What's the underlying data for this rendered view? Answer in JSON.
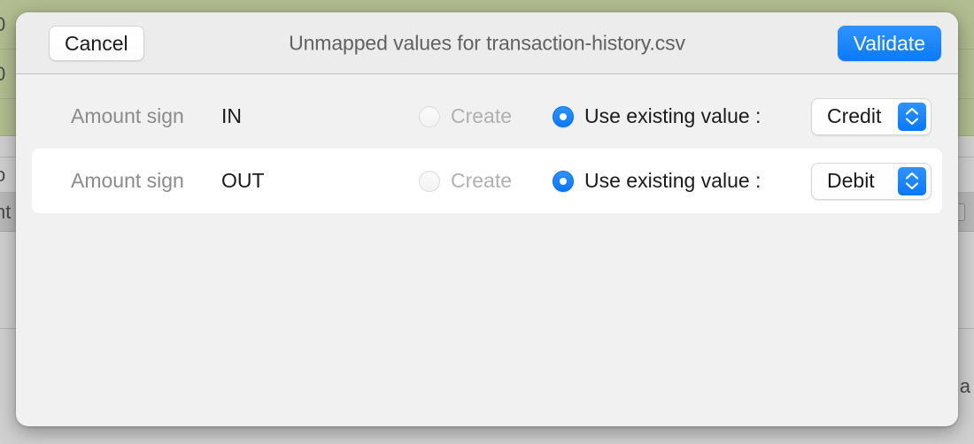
{
  "background": {
    "rows": [
      {
        "style": "green",
        "left_text": "0",
        "right_text": ""
      },
      {
        "style": "green",
        "left_text": "0",
        "right_text": ""
      },
      {
        "style": "green",
        "left_text": "",
        "right_text": ""
      },
      {
        "style": "grey",
        "left_text": "",
        "right_text": ""
      },
      {
        "style": "grey",
        "left_text": "o",
        "right_text": ""
      },
      {
        "style": "grey-dark",
        "left_text": "nt",
        "right_text": "",
        "stepper": "stepper-icon"
      },
      {
        "style": "grey",
        "left_text": "",
        "right_text": ""
      },
      {
        "style": "grey",
        "left_text": "",
        "right_text": "a"
      }
    ]
  },
  "sheet": {
    "title": "Unmapped values for transaction-history.csv",
    "cancel_label": "Cancel",
    "validate_label": "Validate",
    "accent_color": "#0a7bfb",
    "rows": [
      {
        "field_label": "Amount sign",
        "field_value": "IN",
        "create_label": "Create",
        "create_selected": false,
        "create_disabled": true,
        "existing_label": "Use existing value :",
        "existing_selected": true,
        "popup_value": "Credit",
        "selected_row": false
      },
      {
        "field_label": "Amount sign",
        "field_value": "OUT",
        "create_label": "Create",
        "create_selected": false,
        "create_disabled": true,
        "existing_label": "Use existing value :",
        "existing_selected": true,
        "popup_value": "Debit",
        "selected_row": true
      }
    ]
  }
}
